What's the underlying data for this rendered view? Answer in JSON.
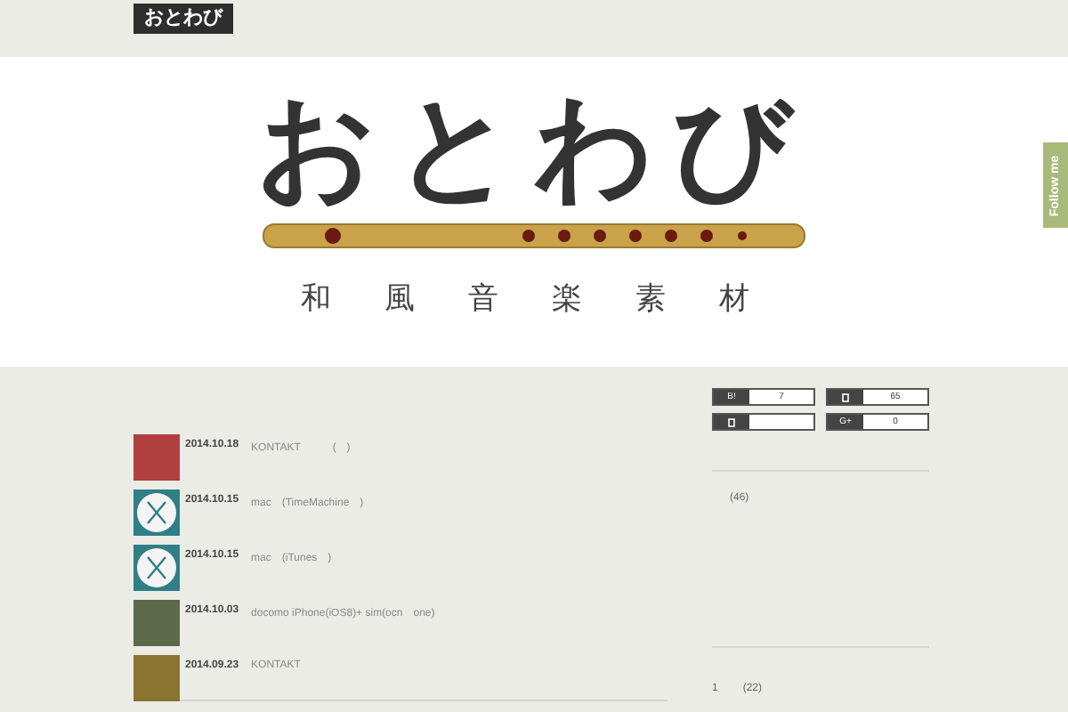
{
  "top_bar": {
    "logo": "おとわび"
  },
  "header": {
    "logo": "おとわび",
    "subtitle": [
      "和",
      "風",
      "音",
      "楽",
      "素",
      "材"
    ]
  },
  "follow_tab": {
    "label": "Follow me"
  },
  "posts": [
    {
      "kind": "photo",
      "date": "2014.10.18",
      "title": "KONTAKT　　　(　)"
    },
    {
      "kind": "mac",
      "date": "2014.10.15",
      "title": "mac　(TimeMachine　)"
    },
    {
      "kind": "mac",
      "date": "2014.10.15",
      "title": "mac　(iTunes　)"
    },
    {
      "kind": "photo",
      "date": "2014.10.03",
      "title": "docomo iPhone(iOS8)+ sim(ocn　one)"
    },
    {
      "kind": "photo",
      "date": "2014.09.23",
      "title": "KONTAKT"
    }
  ],
  "share_buttons": [
    {
      "kind": "text",
      "label": "B!",
      "count": "7"
    },
    {
      "kind": "icon",
      "count": "65"
    },
    {
      "kind": "icon"
    },
    {
      "kind": "text",
      "label": "G+",
      "count": "0"
    }
  ],
  "sidebar": {
    "category_count": "(46)",
    "ranking": [
      {
        "rank": "1",
        "count": "(22)"
      }
    ]
  }
}
